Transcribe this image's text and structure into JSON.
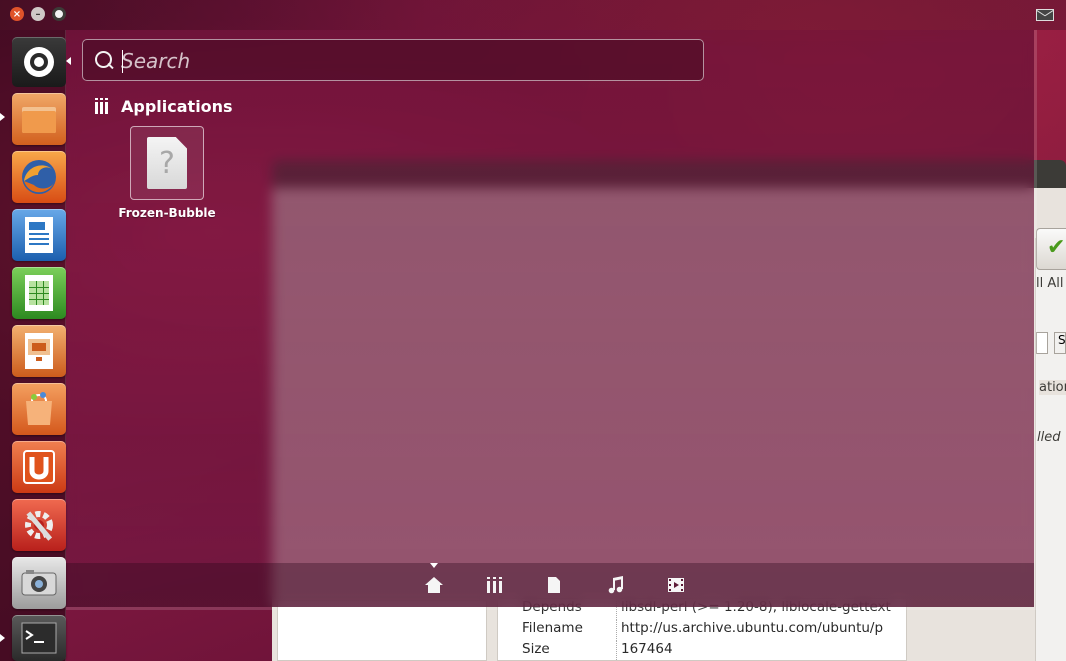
{
  "top_panel": {
    "window_controls": {
      "close_icon": "×",
      "minimize_icon": "–",
      "maximize_icon": ""
    },
    "indicator": "mail-icon"
  },
  "dash": {
    "search": {
      "placeholder": "Search",
      "value": ""
    },
    "section": {
      "icon": "applications-lens-icon",
      "title": "Applications"
    },
    "results": [
      {
        "name": "Frozen-Bubble",
        "icon": "unknown-file-icon",
        "icon_glyph": "?"
      }
    ],
    "lens_bar": {
      "items": [
        {
          "name": "home-lens",
          "icon": "home-icon",
          "active": true
        },
        {
          "name": "applications-lens",
          "icon": "applications-icon",
          "active": false
        },
        {
          "name": "files-lens",
          "icon": "file-icon",
          "active": false
        },
        {
          "name": "music-lens",
          "icon": "music-note-icon",
          "active": false
        },
        {
          "name": "video-lens",
          "icon": "video-icon",
          "active": false
        }
      ]
    }
  },
  "launcher": {
    "items": [
      {
        "name": "dash-home",
        "icon": "ubuntu-logo-icon"
      },
      {
        "name": "files",
        "icon": "folder-icon",
        "color": "#e07a3c"
      },
      {
        "name": "firefox",
        "icon": "firefox-icon",
        "color": "#e0531c"
      },
      {
        "name": "libreoffice-writer",
        "icon": "writer-icon",
        "color": "#2c77c4"
      },
      {
        "name": "libreoffice-calc",
        "icon": "calc-icon",
        "color": "#3aa53a"
      },
      {
        "name": "libreoffice-impress",
        "icon": "impress-icon",
        "color": "#e07a2c"
      },
      {
        "name": "ubuntu-software-center",
        "icon": "software-center-icon",
        "color": "#e07a2c"
      },
      {
        "name": "ubuntu-one",
        "icon": "ubuntu-one-icon",
        "color": "#e0531c"
      },
      {
        "name": "system-settings",
        "icon": "settings-icon",
        "color": "#d4372a"
      },
      {
        "name": "shotwell",
        "icon": "camera-icon",
        "color": "#b8b8b8"
      },
      {
        "name": "terminal",
        "icon": "terminal-icon",
        "color": "#3c3c3c"
      }
    ]
  },
  "background_window": {
    "toolbar_button_partial": "ll All",
    "field_partial": "S",
    "view_partial": "ation",
    "status_partial": "lled",
    "details": [
      {
        "key": "Depends",
        "value": "libsdl-perl (>= 1.20-8), liblocale-gettext"
      },
      {
        "key": "Filename",
        "value": "http://us.archive.ubuntu.com/ubuntu/p"
      },
      {
        "key": "Size",
        "value": "167464"
      }
    ]
  }
}
